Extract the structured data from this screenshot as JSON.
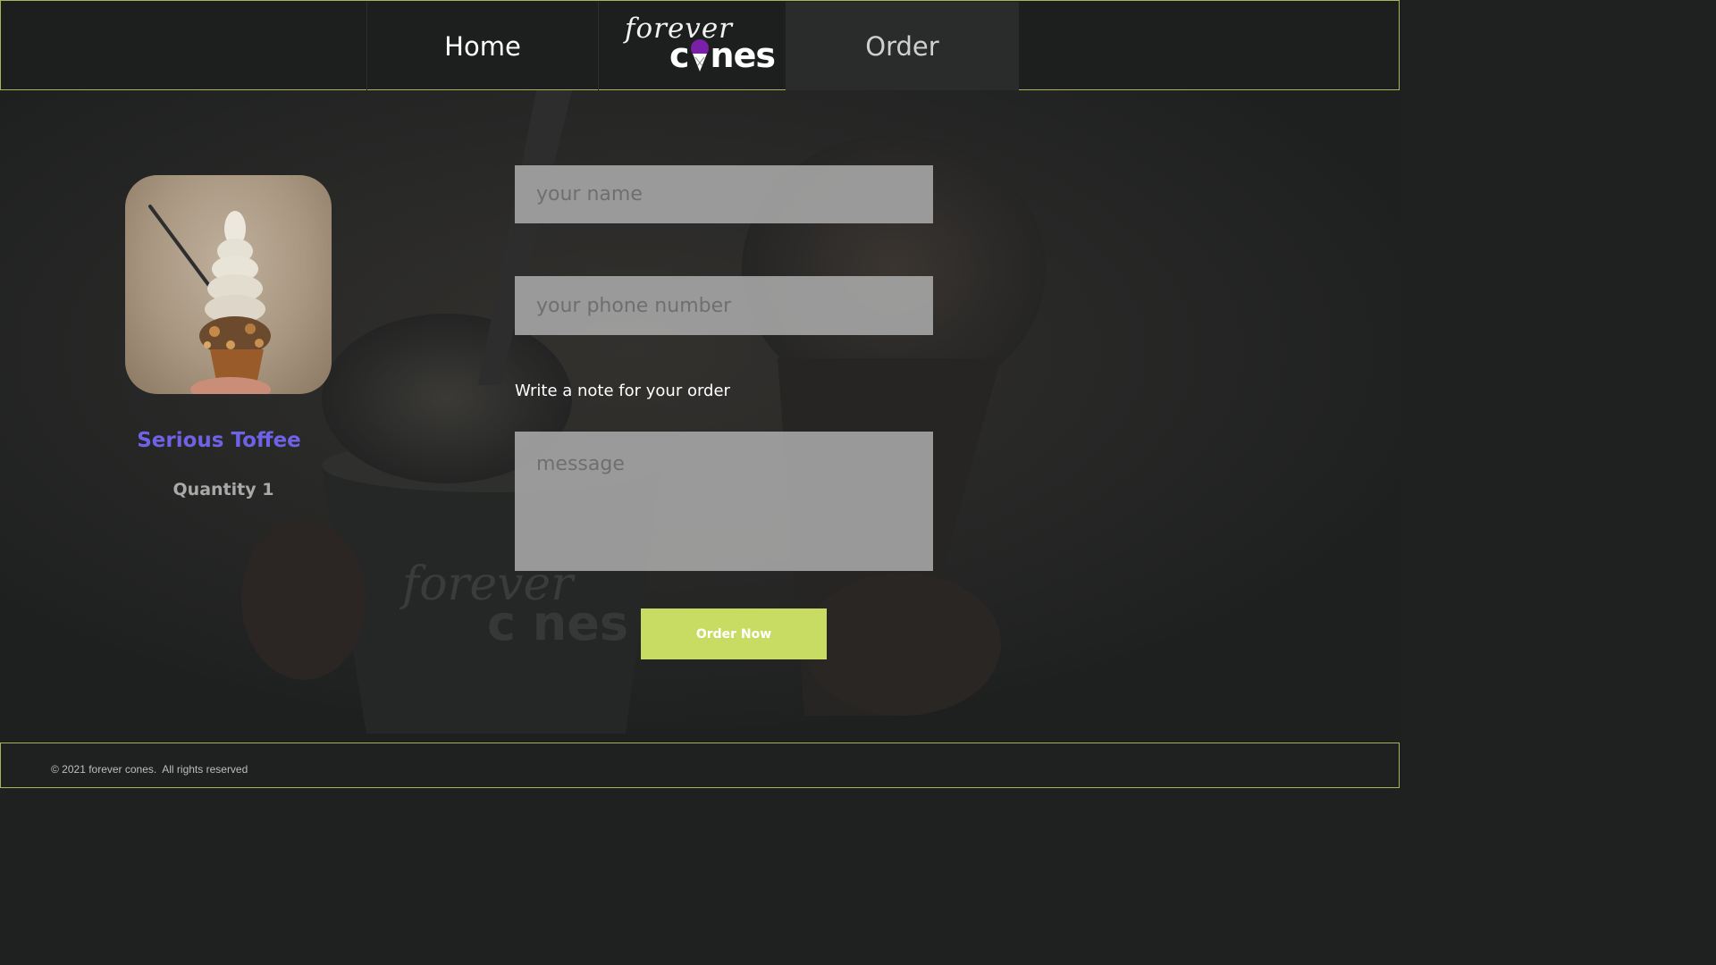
{
  "header": {
    "nav_home": "Home",
    "nav_order": "Order",
    "logo_top": "forever",
    "logo_bottom_c": "c",
    "logo_bottom_nes": "nes",
    "logo_icon": "ice-cream-cone-icon"
  },
  "product": {
    "name": "Serious Toffee",
    "quantity": "Quantity 1",
    "image": "soft-serve-toffee-cone-photo"
  },
  "form": {
    "name_placeholder": "your name",
    "phone_placeholder": "your phone number",
    "note_label": "Write a note for your order",
    "message_placeholder": "message",
    "submit_label": "Order Now"
  },
  "footer": {
    "copyright": "© 2021 forever cones.  All rights reserved"
  },
  "colors": {
    "accent_green": "#c8dc64",
    "border_green": "#a6b55a",
    "product_purple": "#6f62e6",
    "cone_purple": "#7a1fa8",
    "background": "#1f2121"
  }
}
